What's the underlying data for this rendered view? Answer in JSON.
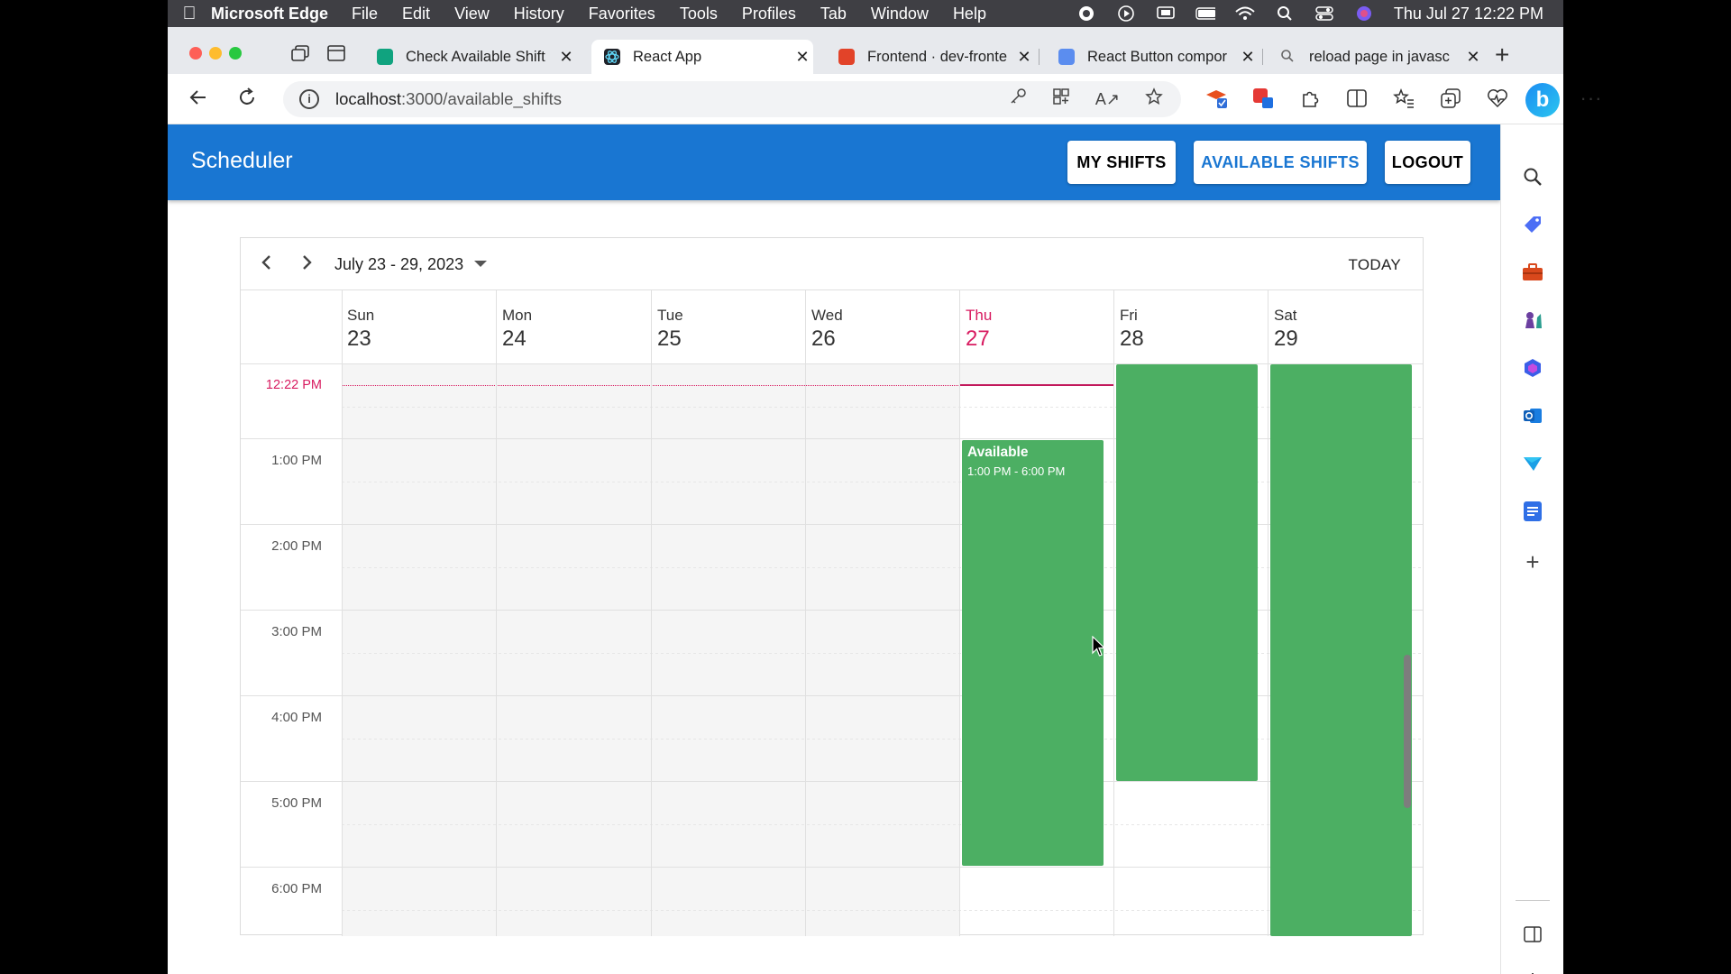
{
  "menubar": {
    "app_name": "Microsoft Edge",
    "items": [
      "File",
      "Edit",
      "View",
      "History",
      "Favorites",
      "Tools",
      "Profiles",
      "Tab",
      "Window",
      "Help"
    ],
    "clock": "Thu Jul 27  12:22 PM"
  },
  "tabs": [
    {
      "title": "Check Available Shift",
      "favicon_color": "#10a37f"
    },
    {
      "title": "React App",
      "favicon_color": "#20232a"
    },
    {
      "title": "Frontend · dev-fronte",
      "favicon_color": "#e24329"
    },
    {
      "title": "React Button compor",
      "favicon_color": "#5b8def"
    },
    {
      "title": "reload page in javasc",
      "favicon_color": "#888888"
    }
  ],
  "address": {
    "host": "localhost",
    "path": ":3000/available_shifts"
  },
  "app": {
    "brand": "Scheduler",
    "nav": {
      "my_shifts": "MY SHIFTS",
      "available_shifts": "AVAILABLE SHIFTS",
      "logout": "LOGOUT"
    },
    "accent": "#1976d2"
  },
  "calendar": {
    "range": "July 23 - 29, 2023",
    "today_label": "TODAY",
    "days": [
      {
        "name": "Sun",
        "date": "23"
      },
      {
        "name": "Mon",
        "date": "24"
      },
      {
        "name": "Tue",
        "date": "25"
      },
      {
        "name": "Wed",
        "date": "26"
      },
      {
        "name": "Thu",
        "date": "27",
        "today": true
      },
      {
        "name": "Fri",
        "date": "28"
      },
      {
        "name": "Sat",
        "date": "29"
      }
    ],
    "now_label": "12:22 PM",
    "hours": [
      "1:00 PM",
      "2:00 PM",
      "3:00 PM",
      "4:00 PM",
      "5:00 PM",
      "6:00 PM"
    ],
    "appointments": [
      {
        "day": "Thu",
        "title": "Available",
        "time": "1:00 PM - 6:00 PM",
        "color": "#4caf63"
      },
      {
        "day": "Fri",
        "title": "",
        "time": "",
        "color": "#4caf63"
      },
      {
        "day": "Sat",
        "title": "",
        "time": "",
        "color": "#4caf63"
      }
    ],
    "today_color": "#d81b60"
  }
}
